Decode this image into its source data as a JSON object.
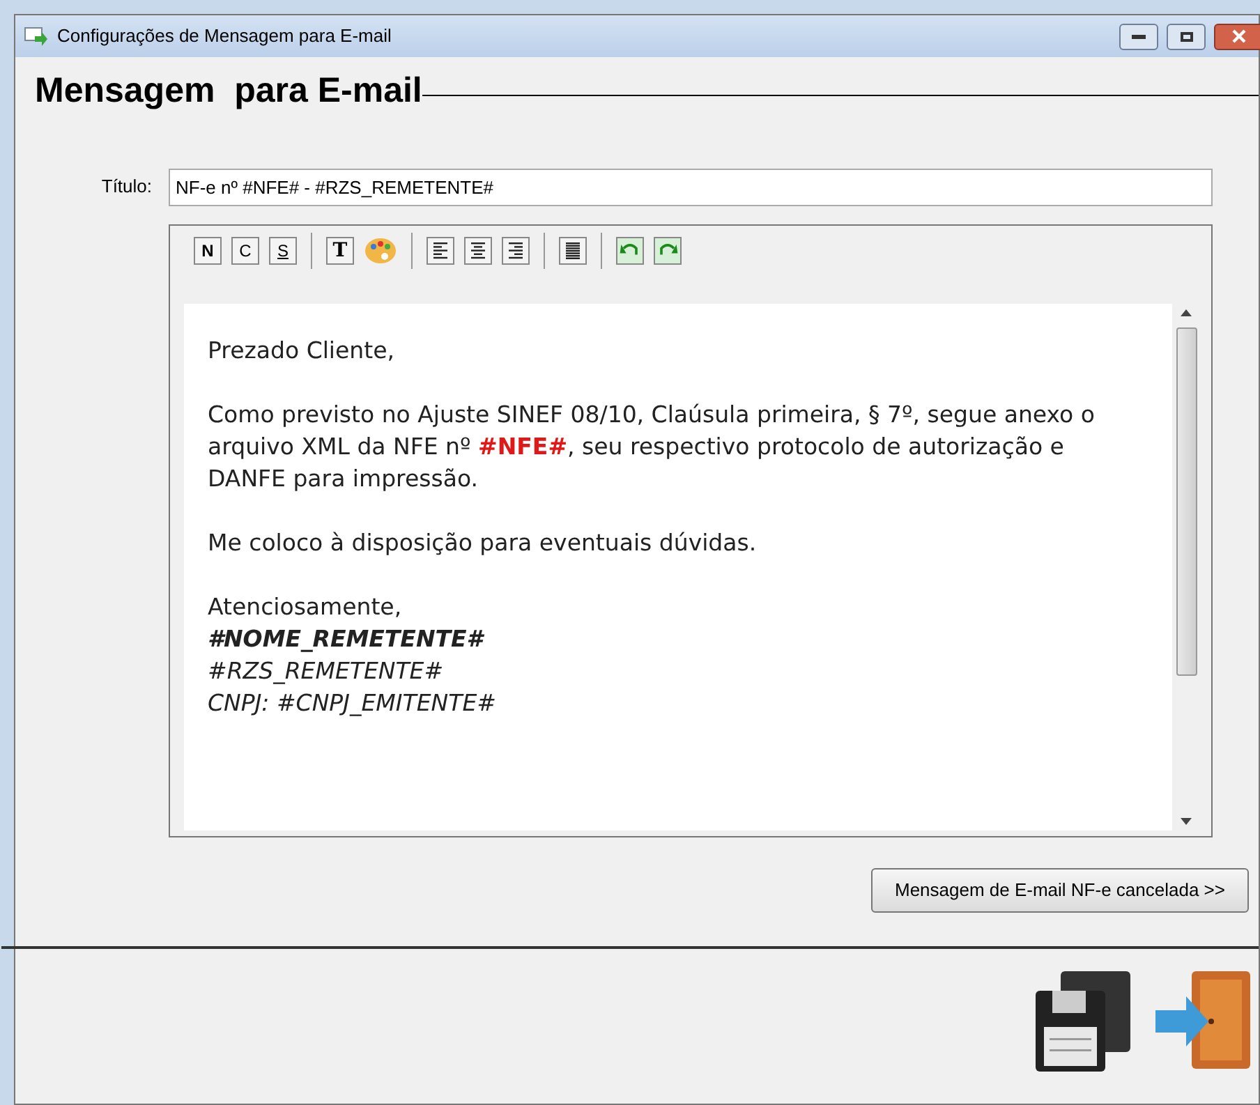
{
  "window": {
    "title": "Configurações de Mensagem para E-mail"
  },
  "heading": "Mensagem  para E-mail",
  "title_field": {
    "label": "Título:",
    "value": "NF-e nº #NFE# - #RZS_REMETENTE#"
  },
  "toolbar": [
    {
      "kind": "bold",
      "text": "N"
    },
    {
      "kind": "italic",
      "text": "C"
    },
    {
      "kind": "underline",
      "text": "S"
    },
    {
      "kind": "separator"
    },
    {
      "kind": "font",
      "text": "T"
    },
    {
      "kind": "palette"
    },
    {
      "kind": "separator"
    },
    {
      "kind": "left"
    },
    {
      "kind": "center"
    },
    {
      "kind": "right"
    },
    {
      "kind": "separator"
    },
    {
      "kind": "justify"
    },
    {
      "kind": "separator"
    },
    {
      "kind": "undo"
    },
    {
      "kind": "redo"
    }
  ],
  "editor": [
    {
      "kind": "plain",
      "segments": [
        {
          "text": "Prezado Cliente,",
          "kind": "normal"
        }
      ]
    },
    {
      "kind": "gap"
    },
    {
      "kind": "plain",
      "segments": [
        {
          "text": "Como previsto no Ajuste SINEF 08/10, Claúsula primeira, § 7º, segue anexo o arquivo XML da NFE nº ",
          "kind": "normal"
        },
        {
          "text": "#NFE#",
          "kind": "highlight"
        },
        {
          "text": ", seu respectivo protocolo de autorização e DANFE para impressão.",
          "kind": "normal"
        }
      ]
    },
    {
      "kind": "gap"
    },
    {
      "kind": "plain",
      "segments": [
        {
          "text": "Me coloco à disposição para eventuais dúvidas.",
          "kind": "normal"
        }
      ]
    },
    {
      "kind": "gap"
    },
    {
      "kind": "plain",
      "segments": [
        {
          "text": "Atenciosamente,",
          "kind": "normal"
        }
      ]
    },
    {
      "kind": "bolditalic",
      "segments": [
        {
          "text": "#NOME_REMETENTE#",
          "kind": "normal"
        }
      ]
    },
    {
      "kind": "italic",
      "segments": [
        {
          "text": "#RZS_REMETENTE#",
          "kind": "normal"
        }
      ]
    },
    {
      "kind": "italic",
      "segments": [
        {
          "text": "CNPJ:  #CNPJ_EMITENTE#",
          "kind": "normal"
        }
      ]
    }
  ],
  "secondary_button": "Mensagem de E-mail NF-e cancelada >>"
}
